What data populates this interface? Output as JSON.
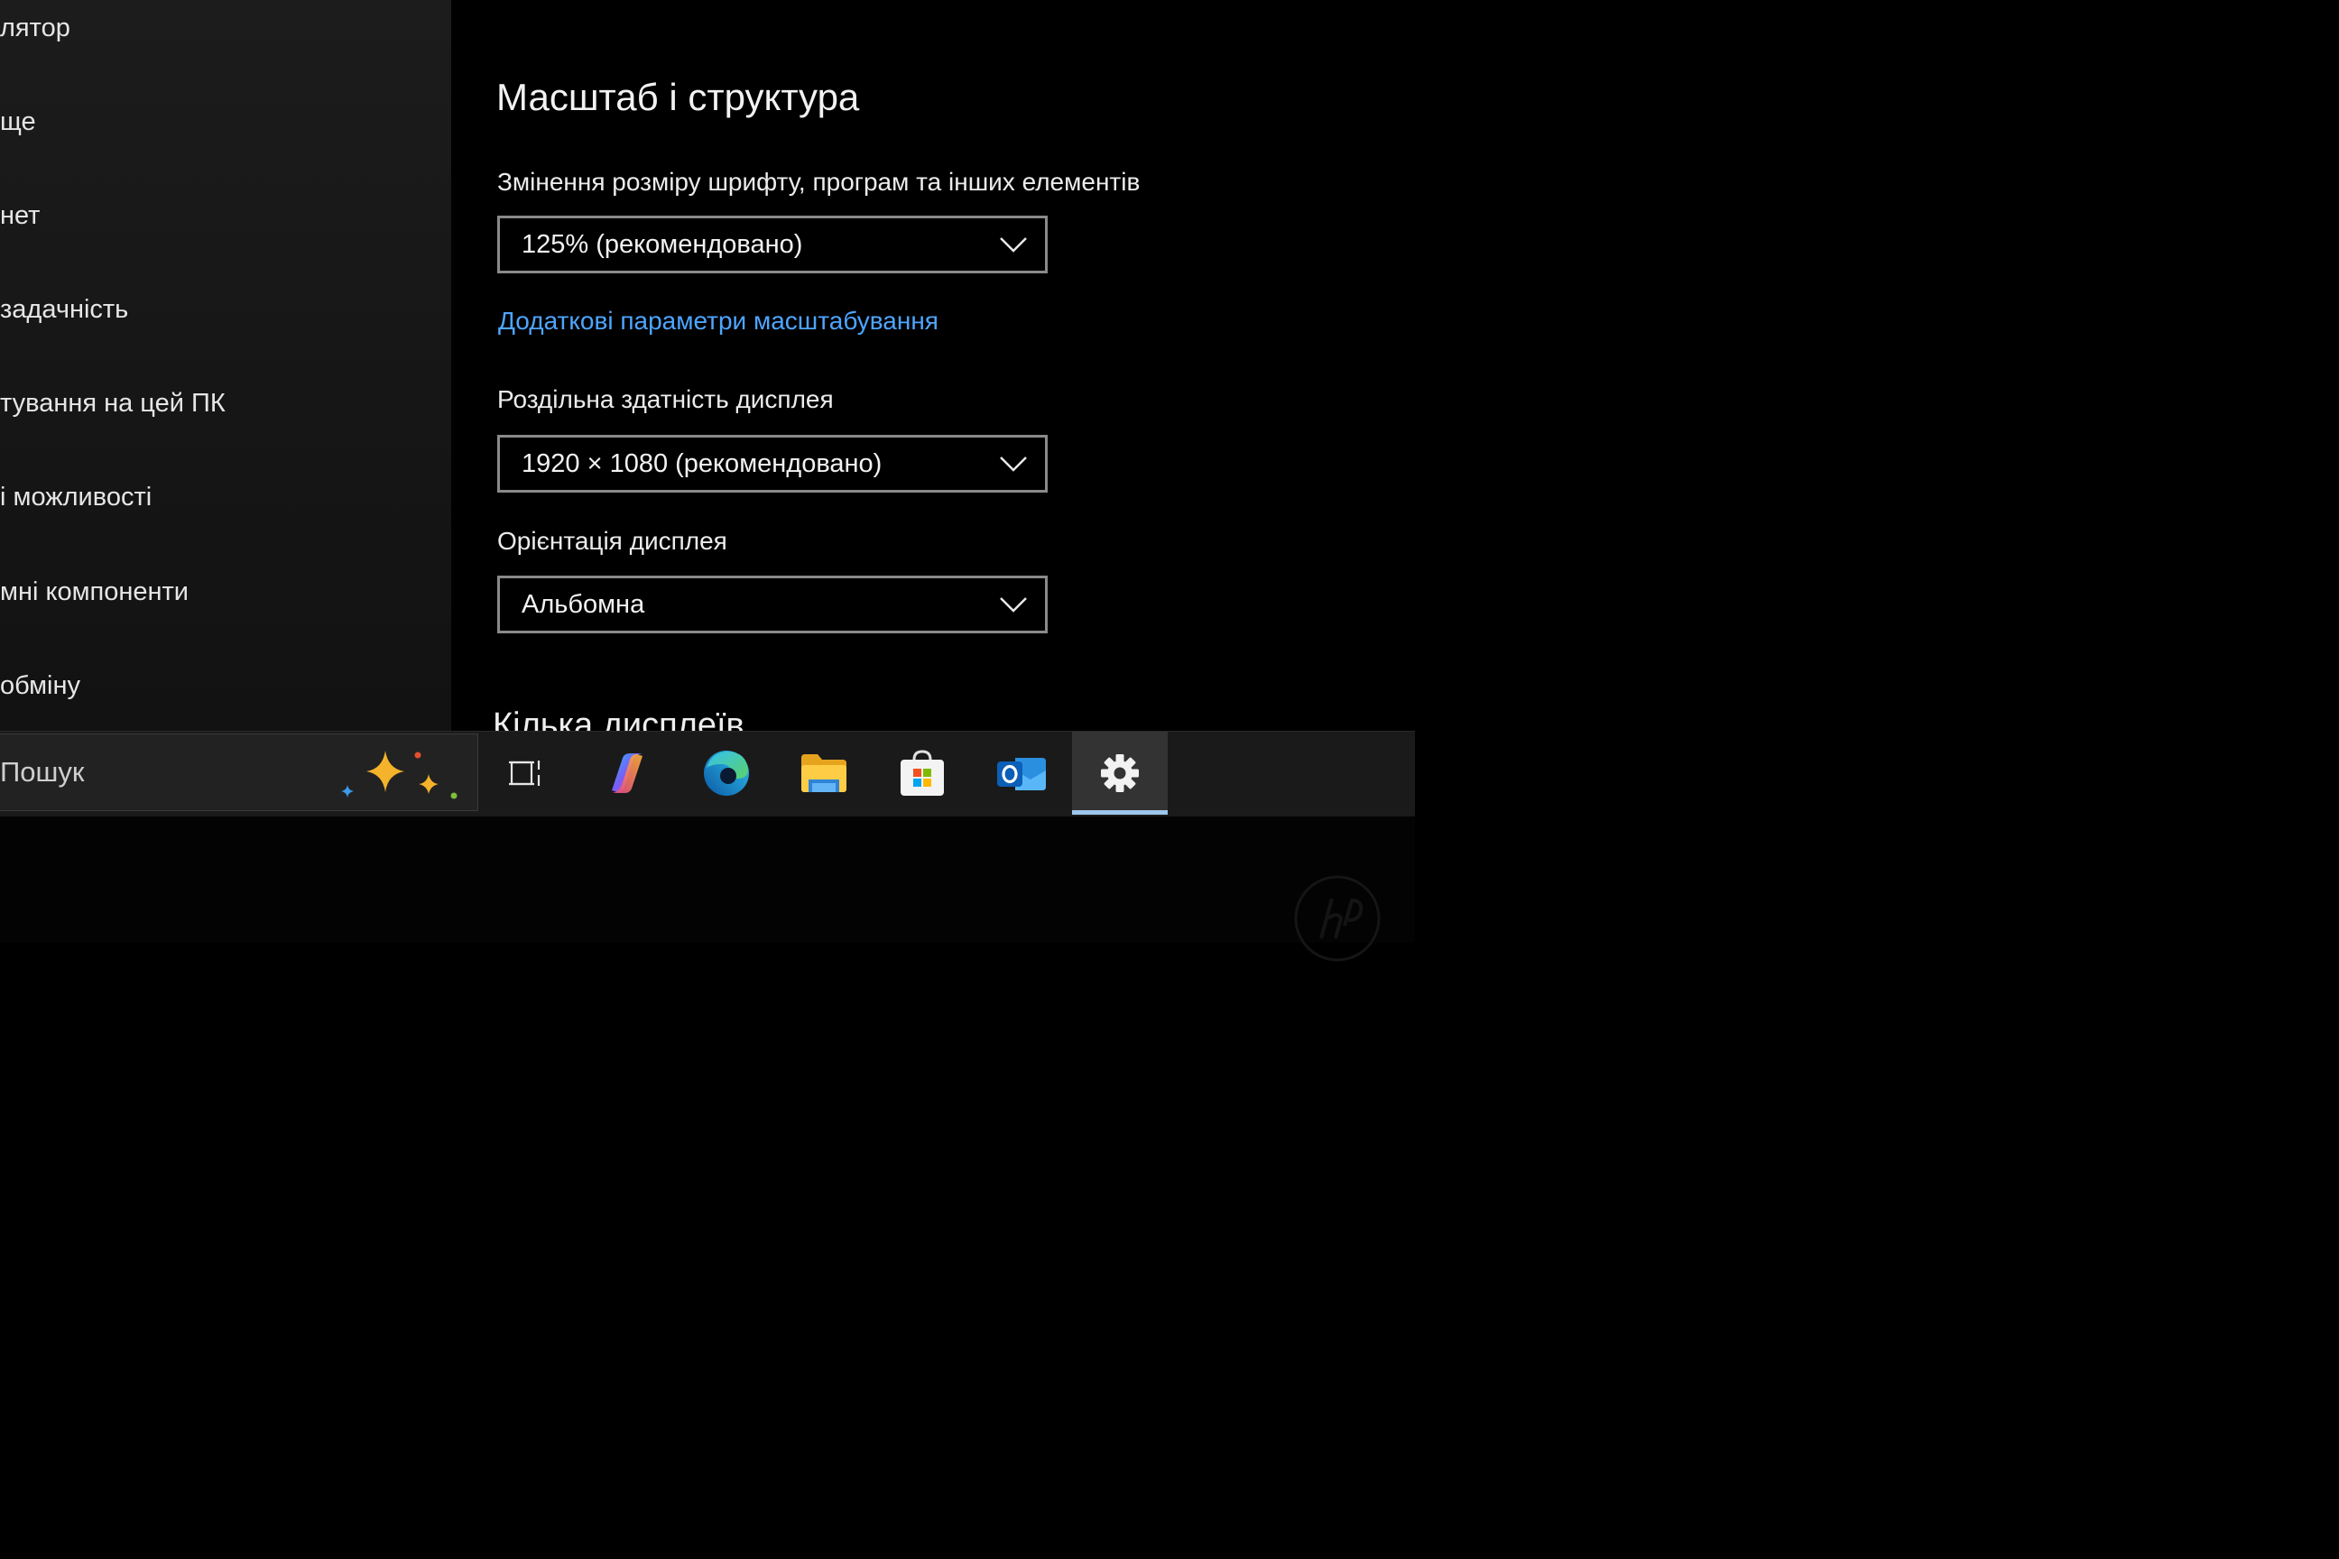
{
  "sidebar": {
    "items": [
      {
        "label": "лятор"
      },
      {
        "label": "ще"
      },
      {
        "label": "нет"
      },
      {
        "label": "задачність"
      },
      {
        "label": "тування на цей ПК"
      },
      {
        "label": "і можливості"
      },
      {
        "label": "мні компоненти"
      },
      {
        "label": "обміну"
      }
    ]
  },
  "main": {
    "title": "Масштаб і структура",
    "scale": {
      "label": "Змінення розміру шрифту, програм та інших елементів",
      "value": "125% (рекомендовано)"
    },
    "advanced_link": "Додаткові параметри масштабування",
    "resolution": {
      "label": "Роздільна здатність дисплея",
      "value": "1920 × 1080 (рекомендовано)"
    },
    "orientation": {
      "label": "Орієнтація дисплея",
      "value": "Альбомна"
    },
    "next_section": "Кілька дисплеїв"
  },
  "taskbar": {
    "search_text": "Пошук",
    "icons": [
      "task-view-icon",
      "copilot-icon",
      "edge-icon",
      "file-explorer-icon",
      "microsoft-store-icon",
      "outlook-icon",
      "settings-icon"
    ],
    "active": "settings-icon",
    "accent_color": "#9dc6ec"
  },
  "colors": {
    "link": "#4ea5ff",
    "select_border": "#8a8a8a"
  }
}
